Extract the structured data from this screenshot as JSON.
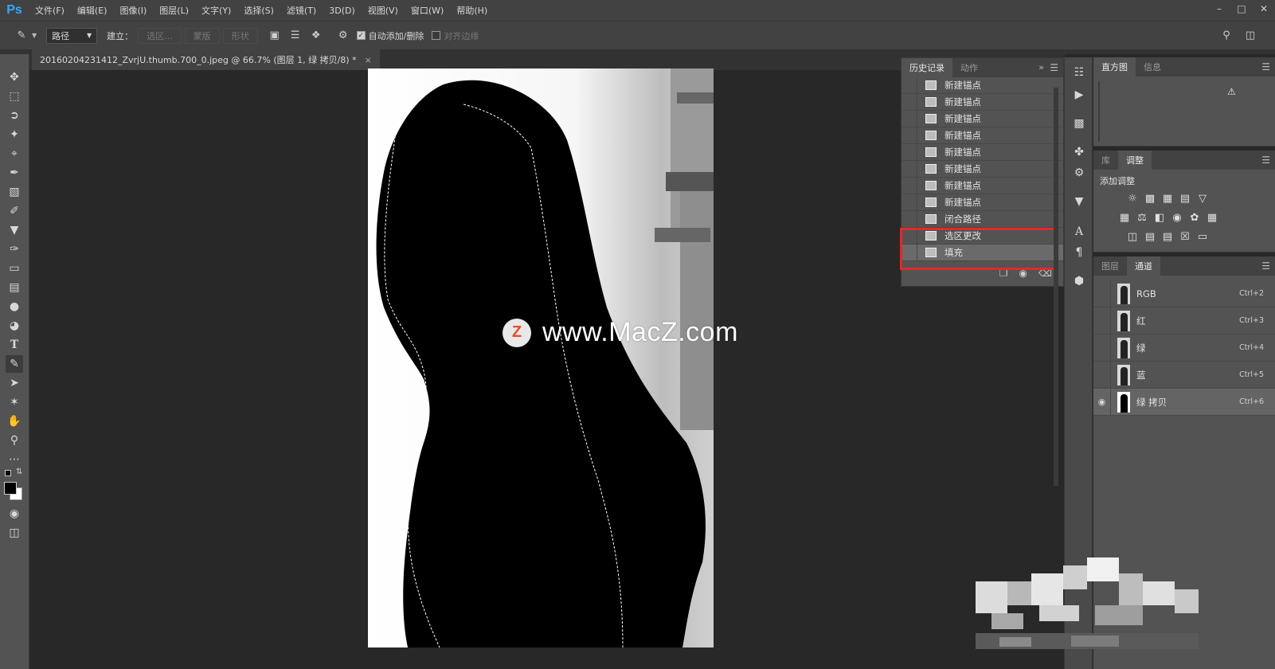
{
  "menubar": {
    "logo": "Ps",
    "items": [
      "文件(F)",
      "编辑(E)",
      "图像(I)",
      "图层(L)",
      "文字(Y)",
      "选择(S)",
      "滤镜(T)",
      "3D(D)",
      "视图(V)",
      "窗口(W)",
      "帮助(H)"
    ],
    "window_controls": [
      "minimize-icon",
      "maximize-icon",
      "close-icon"
    ]
  },
  "options": {
    "mode_value": "路径",
    "make_label": "建立：",
    "selection_btn": "选区...",
    "mask_btn": "蒙版",
    "shape_btn": "形状",
    "auto_add_label": "自动添加/删除",
    "align_edges_label": "对齐边缘"
  },
  "document": {
    "tab_title": "20160204231412_ZvrjU.thumb.700_0.jpeg @ 66.7% (图层 1, 绿 拷贝/8) *",
    "close": "×"
  },
  "watermark": {
    "logo": "Z",
    "text": "www.MacZ.com"
  },
  "history_panel": {
    "tabs": [
      "历史记录",
      "动作"
    ],
    "items": [
      {
        "label": "新建锚点"
      },
      {
        "label": "新建锚点"
      },
      {
        "label": "新建锚点"
      },
      {
        "label": "新建锚点"
      },
      {
        "label": "新建锚点"
      },
      {
        "label": "新建锚点"
      },
      {
        "label": "新建锚点"
      },
      {
        "label": "新建锚点"
      },
      {
        "label": "闭合路径"
      },
      {
        "label": "选区更改"
      },
      {
        "label": "填充"
      }
    ],
    "highlight_color": "#e12a2a"
  },
  "histogram_panel": {
    "tabs": [
      "直方图",
      "信息"
    ],
    "warning_icon": "warning-icon"
  },
  "adjustments_panel": {
    "tabs": [
      "库",
      "调整"
    ],
    "title": "添加调整"
  },
  "channels_panel": {
    "tabs": [
      "图层",
      "通道"
    ],
    "channels": [
      {
        "name": "RGB",
        "shortcut": "Ctrl+2"
      },
      {
        "name": "红",
        "shortcut": "Ctrl+3"
      },
      {
        "name": "绿",
        "shortcut": "Ctrl+4"
      },
      {
        "name": "蓝",
        "shortcut": "Ctrl+5"
      },
      {
        "name": "绿 拷贝",
        "shortcut": "Ctrl+6",
        "visible": true,
        "selected": true
      }
    ]
  },
  "colors": {
    "accent": "#31a8ff",
    "panel_bg": "#535353",
    "workspace": "#282828"
  }
}
